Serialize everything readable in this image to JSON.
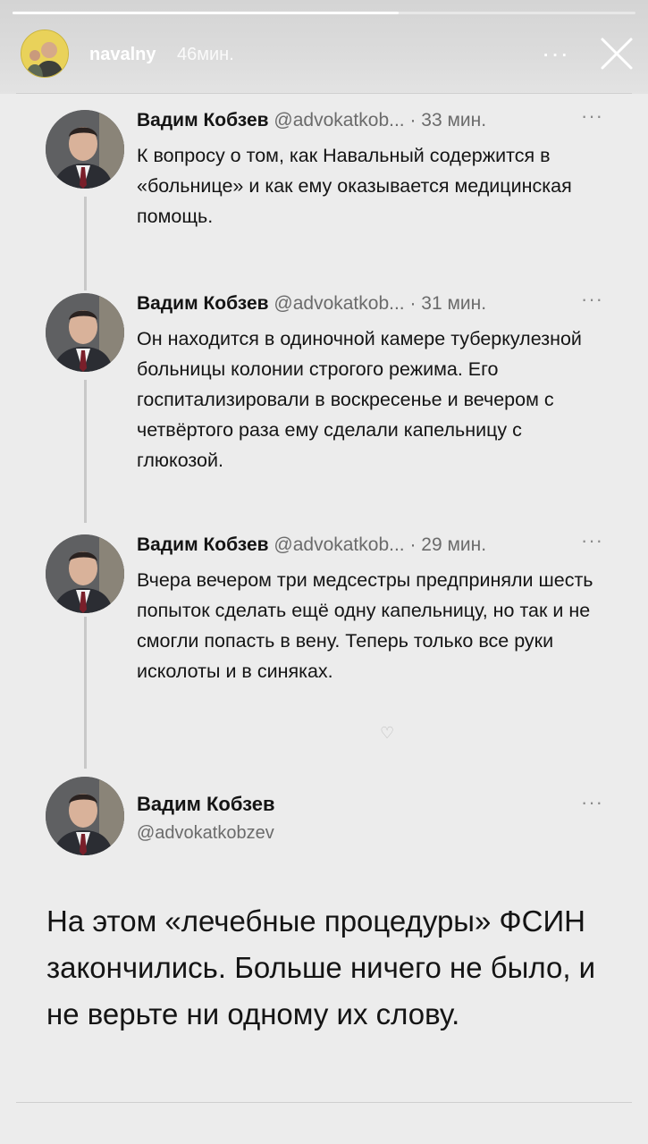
{
  "story": {
    "progress": 0.62,
    "username": "navalny",
    "time": "46мин.",
    "more_icon": "ellipsis-icon",
    "close_icon": "close-icon"
  },
  "tweets": [
    {
      "name": "Вадим Кобзев",
      "handle": "@advokatkob...",
      "time": "· 33 мин.",
      "text": "К вопросу о том, как Навальный содержится в «больнице» и как ему оказывается медицинская помощь."
    },
    {
      "name": "Вадим Кобзев",
      "handle": "@advokatkob...",
      "time": "· 31 мин.",
      "text": "Он находится в одиночной камере туберкулезной больницы колонии строгого режима. Его госпитализировали в воскресенье и вечером с четвёртого раза ему сделали капельницу с глюкозой."
    },
    {
      "name": "Вадим Кобзев",
      "handle": "@advokatkob...",
      "time": "· 29 мин.",
      "text": "Вчера вечером три медсестры предприняли шесть попыток сделать ещё одну капельницу, но так и не смогли попасть в вену. Теперь только все руки исколоты и в синяках."
    }
  ],
  "last_tweet": {
    "name": "Вадим Кобзев",
    "handle": "@advokatkobzev",
    "text": "На этом «лечебные процедуры» ФСИН закончились. Больше ничего не было, и не верьте ни одному их слову."
  },
  "more_label": "···"
}
